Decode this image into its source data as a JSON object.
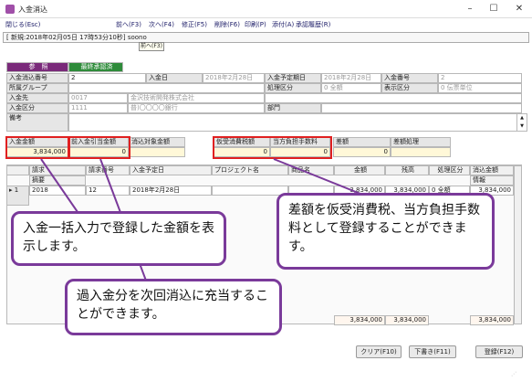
{
  "window": {
    "title": "入金消込",
    "min": "–",
    "max": "☐",
    "close": "✕"
  },
  "toolbar": {
    "close": "閉じる(Esc)",
    "prev": "前へ(F3)",
    "next": "次へ(F4)",
    "edit": "修正(F5)",
    "delete": "削除(F6)",
    "print": "印刷(P)",
    "attach": "添付(A)",
    "history": "承認履歴(R)"
  },
  "info": "[ 新規:2018年02月05日 17時53分10秒] soono",
  "tooltip": "前へ(F3)",
  "status": {
    "badge": "参　照",
    "approval": "最終承認済"
  },
  "form": {
    "no_label": "入金消込番号",
    "no_value": "2",
    "nyukin_label": "入金日",
    "nyukin_value": "2018年2月28日",
    "yotei_label": "入金予定期日",
    "yotei_value": "2018年2月28日",
    "bango_label": "入金番号",
    "bango_value": "2",
    "group_label": "所属グループ",
    "shori_label": "処理区分",
    "shori_value": "0 全額",
    "hyoji_label": "表示区分",
    "hyoji_value": "0 伝票単位",
    "saki_label": "入金先",
    "saki_code": "0017",
    "saki_name": "金沢技術開発株式会社",
    "kubun_label": "入金区分",
    "kubun_code": "1111",
    "kubun_name": "普)〇〇〇〇銀行",
    "bumon_label": "部門",
    "biko_label": "備考"
  },
  "summary": {
    "kingaku_label": "入金金額",
    "kingaku_value": "3,834,000",
    "hikiate_label": "前入金引当金額",
    "hikiate_value": "0",
    "taisho_label": "消込対象金額",
    "taisho_value": "",
    "karibarai_label": "仮受消費税額",
    "karibarai_value": "0",
    "futan_label": "当方負担手数料",
    "futan_value": "0",
    "sagaku_label": "差額",
    "sagaku_value": "0",
    "sagaku_shori_label": "差額処理"
  },
  "grid": {
    "h_seikyu": "請求",
    "h_tekiyo": "摘要",
    "h_seikyu_no": "請求番号",
    "h_yotei": "入金予定日",
    "h_project": "プロジェクト名",
    "h_shohin": "商品名",
    "h_kingaku": "金額",
    "h_zandaka": "残高",
    "h_shori": "処理区分",
    "h_keshikomi": "消込金額",
    "h_joho": "情報",
    "row_marker": "▸ 1",
    "row_date": "2018",
    "row_no": "12",
    "row_yotei": "2018年2月28日",
    "row_kingaku": "3,834,000",
    "row_zandaka": "3,834,000",
    "row_shori": "0 全額",
    "row_keshi": "3,834,000",
    "total_kingaku": "3,834,000",
    "total_zandaka": "3,834,000",
    "total_keshi": "3,834,000"
  },
  "buttons": {
    "clear": "クリア(F10)",
    "draft": "下書き(F11)",
    "register": "登録(F12)"
  },
  "callouts": {
    "c1": "入金一括入力で登録した金額を表示します。",
    "c2": "過入金分を次回消込に充当することができます。",
    "c3": "差額を仮受消費税、当方負担手数料として登録することができます。"
  }
}
